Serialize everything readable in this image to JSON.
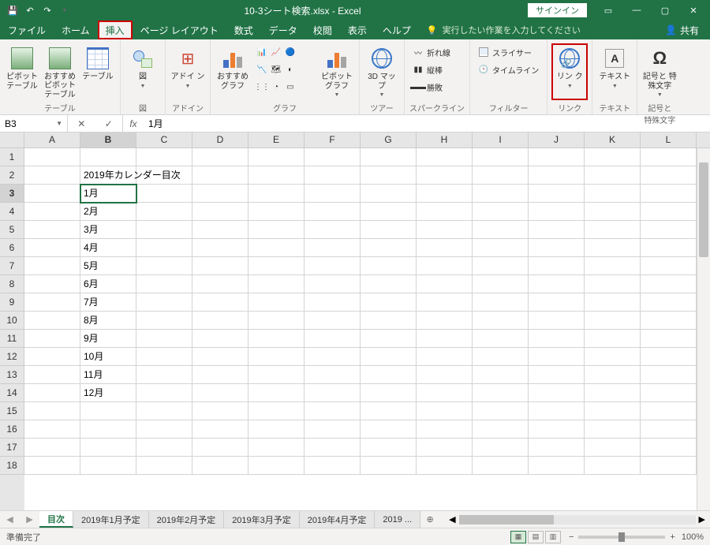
{
  "titlebar": {
    "filename": "10-3シート検索.xlsx  -  Excel",
    "signin": "サインイン"
  },
  "tabs": {
    "file": "ファイル",
    "items": [
      "ホーム",
      "挿入",
      "ページ レイアウト",
      "数式",
      "データ",
      "校閲",
      "表示",
      "ヘルプ"
    ],
    "active": "挿入",
    "tellme": "実行したい作業を入力してください",
    "share": "共有"
  },
  "ribbon": {
    "groups": {
      "tables": {
        "label": "テーブル",
        "btns": [
          "ピボット\nテーブル",
          "おすすめ\nピボットテーブル",
          "テーブル"
        ]
      },
      "illust": {
        "label": "図",
        "btns": [
          "図"
        ]
      },
      "addin": {
        "label": "アドイン",
        "btns": [
          "アドイ\nン"
        ]
      },
      "charts": {
        "label": "グラフ",
        "btns": [
          "おすすめ\nグラフ",
          "",
          "ピボットグラフ"
        ]
      },
      "tours": {
        "label": "ツアー",
        "btns": [
          "3D\nマップ"
        ]
      },
      "spark": {
        "label": "スパークライン",
        "items": [
          "折れ線",
          "縦棒",
          "勝敗"
        ]
      },
      "filter": {
        "label": "フィルター",
        "items": [
          "スライサー",
          "タイムライン"
        ]
      },
      "link": {
        "label": "リンク",
        "btns": [
          "リン\nク"
        ]
      },
      "text": {
        "label": "テキスト",
        "btns": [
          "テキスト"
        ]
      },
      "sym": {
        "label": "記号と\n特殊文字",
        "btns": [
          "記号と\n特殊文字"
        ]
      }
    }
  },
  "formula": {
    "namebox": "B3",
    "value": "1月"
  },
  "cols": [
    "A",
    "B",
    "C",
    "D",
    "E",
    "F",
    "G",
    "H",
    "I",
    "J",
    "K",
    "L"
  ],
  "selectedCol": "B",
  "selectedRow": 3,
  "rows": [
    {
      "n": 1,
      "B": ""
    },
    {
      "n": 2,
      "B": "2019年カレンダー目次"
    },
    {
      "n": 3,
      "B": "1月"
    },
    {
      "n": 4,
      "B": "2月"
    },
    {
      "n": 5,
      "B": "3月"
    },
    {
      "n": 6,
      "B": "4月"
    },
    {
      "n": 7,
      "B": "5月"
    },
    {
      "n": 8,
      "B": "6月"
    },
    {
      "n": 9,
      "B": "7月"
    },
    {
      "n": 10,
      "B": "8月"
    },
    {
      "n": 11,
      "B": "9月"
    },
    {
      "n": 12,
      "B": "10月"
    },
    {
      "n": 13,
      "B": "11月"
    },
    {
      "n": 14,
      "B": "12月"
    },
    {
      "n": 15,
      "B": ""
    },
    {
      "n": 16,
      "B": ""
    },
    {
      "n": 17,
      "B": ""
    },
    {
      "n": 18,
      "B": ""
    }
  ],
  "sheets": {
    "active": "目次",
    "others": [
      "2019年1月予定",
      "2019年2月予定",
      "2019年3月予定",
      "2019年4月予定",
      "2019 ..."
    ]
  },
  "status": {
    "ready": "準備完了",
    "zoom": "100%"
  }
}
